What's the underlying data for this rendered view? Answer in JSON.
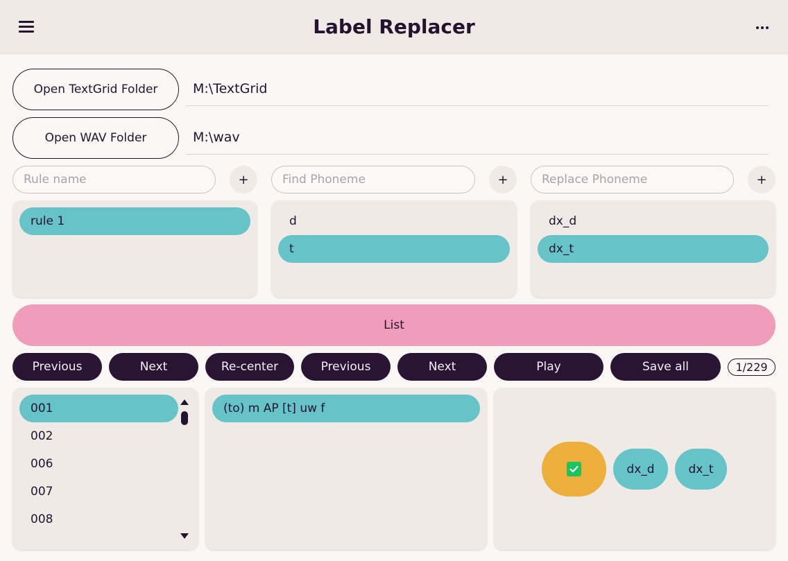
{
  "app": {
    "title": "Label Replacer"
  },
  "folders": {
    "textgrid_button": "Open TextGrid Folder",
    "textgrid_path": "M:\\TextGrid",
    "wav_button": "Open WAV Folder",
    "wav_path": "M:\\wav"
  },
  "inputs": {
    "rule_placeholder": "Rule name",
    "find_placeholder": "Find Phoneme",
    "replace_placeholder": "Replace Phoneme",
    "add_label": "+"
  },
  "rules": [
    {
      "label": "rule 1",
      "selected": true
    }
  ],
  "find_phonemes": [
    {
      "label": "d",
      "selected": false
    },
    {
      "label": "t",
      "selected": true
    }
  ],
  "replace_phonemes": [
    {
      "label": "dx_d",
      "selected": false
    },
    {
      "label": "dx_t",
      "selected": true
    }
  ],
  "list_button": "List",
  "toolbar": {
    "previous_1": "Previous",
    "next_1": "Next",
    "recenter": "Re-center",
    "previous_2": "Previous",
    "next_2": "Next",
    "play": "Play",
    "save_all": "Save all",
    "counter": "1/229"
  },
  "files": [
    {
      "label": "001",
      "selected": true
    },
    {
      "label": "002",
      "selected": false
    },
    {
      "label": "006",
      "selected": false
    },
    {
      "label": "007",
      "selected": false
    },
    {
      "label": "008",
      "selected": false
    }
  ],
  "contexts": [
    {
      "label": "(to) m AP [t] uw f",
      "selected": true
    }
  ],
  "choices": {
    "checked": true,
    "options": [
      "dx_d",
      "dx_t"
    ]
  },
  "colors": {
    "accent_teal": "#66c3c8",
    "list_pink": "#f09dbb",
    "dark_button": "#2a1433",
    "check_orange": "#edaf3b",
    "check_green": "#18c55e"
  }
}
